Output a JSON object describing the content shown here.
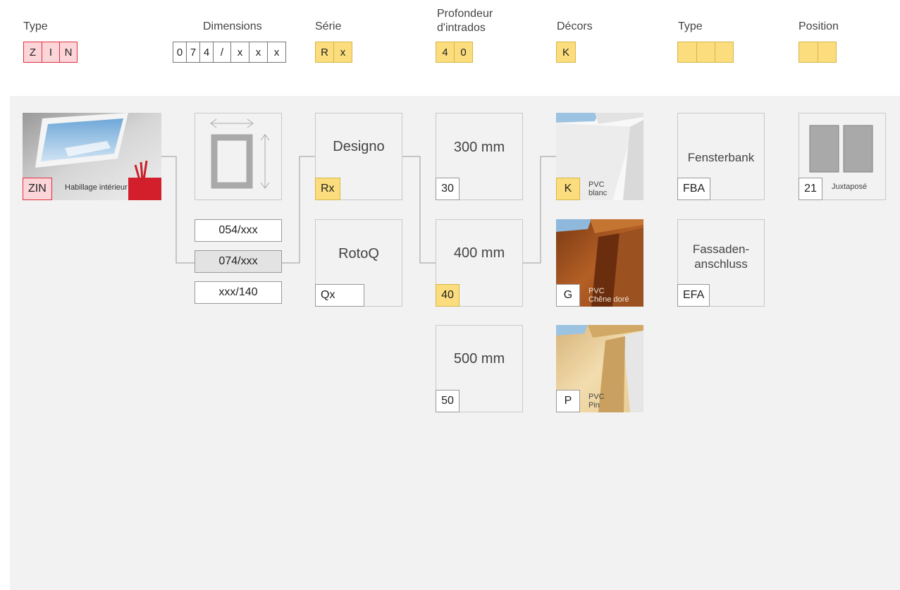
{
  "header": {
    "type": {
      "label": "Type",
      "code": [
        "Z",
        "I",
        "N"
      ]
    },
    "dimensions": {
      "label": "Dimensions",
      "code": [
        "0",
        "7",
        "4",
        "/",
        "x",
        "x",
        "x"
      ]
    },
    "serie": {
      "label": "Série",
      "code": [
        "R",
        "x"
      ]
    },
    "profondeur": {
      "label_line1": "Profondeur",
      "label_line2": "d'intrados",
      "code": [
        "4",
        "0"
      ]
    },
    "decors": {
      "label": "Décors",
      "code": [
        "K"
      ]
    },
    "type2": {
      "label": "Type",
      "code": [
        "",
        "",
        ""
      ]
    },
    "position": {
      "label": "Position",
      "code": [
        "",
        ""
      ]
    }
  },
  "type_option": {
    "code": "ZIN",
    "caption": "Habillage intérieur"
  },
  "dimensions": {
    "options": [
      "054/xxx",
      "074/xxx",
      "xxx/140"
    ],
    "selected": "074/xxx"
  },
  "series": [
    {
      "title": "Designo",
      "code": "Rx",
      "selected": true
    },
    {
      "title": "RotoQ",
      "code": "Qx",
      "selected": false
    }
  ],
  "depths": [
    {
      "title": "300 mm",
      "code": "30",
      "selected": false
    },
    {
      "title": "400 mm",
      "code": "40",
      "selected": true
    },
    {
      "title": "500 mm",
      "code": "50",
      "selected": false
    }
  ],
  "decors": [
    {
      "code": "K",
      "line1": "PVC",
      "line2": "blanc",
      "selected": true
    },
    {
      "code": "G",
      "line1": "PVC",
      "line2": "Chêne doré",
      "selected": false
    },
    {
      "code": "P",
      "line1": "PVC",
      "line2": "Pin",
      "selected": false
    }
  ],
  "types": [
    {
      "title": "Fensterbank",
      "code": "FBA"
    },
    {
      "title_line1": "Fassaden-",
      "title_line2": "anschluss",
      "code": "EFA"
    }
  ],
  "position_option": {
    "code": "21",
    "caption": "Juxtaposé"
  },
  "colors": {
    "accent_red": "#e0303f",
    "accent_yellow": "#fbdd7e",
    "panel_bg": "#f2f2f2"
  }
}
